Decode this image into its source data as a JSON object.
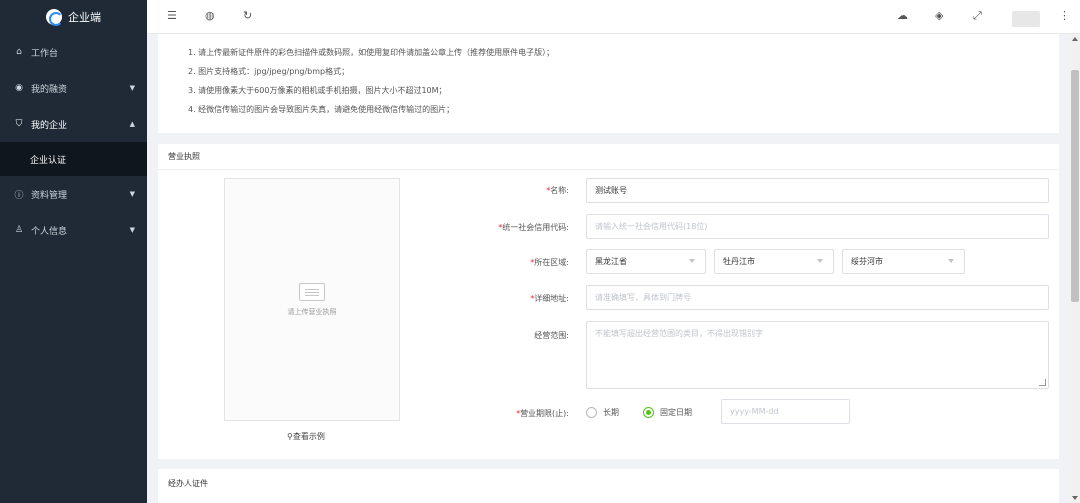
{
  "sidebar": {
    "brand": "企业端",
    "items": [
      {
        "label": "工作台",
        "icon": "home-icon"
      },
      {
        "label": "我的融资",
        "icon": "finance-icon"
      },
      {
        "label": "我的企业",
        "icon": "shield-icon"
      },
      {
        "label": "资料管理",
        "icon": "info-icon"
      },
      {
        "label": "个人信息",
        "icon": "user-icon"
      }
    ],
    "sub_items": [
      {
        "label": "企业认证"
      }
    ]
  },
  "topbar": {
    "icons": [
      "menu-icon",
      "globe-icon",
      "refresh-icon",
      "palette-icon",
      "tag-icon",
      "fullscreen-icon",
      "more-icon"
    ]
  },
  "notes": [
    "1. 请上传最新证件原件的彩色扫描件或数码照，如使用复印件请加盖公章上传（推荐使用原件电子版）；",
    "2. 图片支持格式：jpg/jpeg/png/bmp格式；",
    "3. 请使用像素大于600万像素的相机或手机拍摄，图片大小不超过10M；",
    "4. 经微信传输过的图片会导致图片失真，请避免使用经微信传输过的图片；"
  ],
  "license": {
    "title": "营业执照",
    "upload_text": "请上传营业执照",
    "example_link": "查看示例",
    "fields": {
      "name_label": "名称:",
      "name_value": "测试账号",
      "credit_label": "统一社会信用代码:",
      "credit_placeholder": "请输入统一社会信用代码(18位)",
      "region_label": "所在区域:",
      "province": "黑龙江省",
      "city": "牡丹江市",
      "district": "绥芬河市",
      "address_label": "详细地址:",
      "address_placeholder": "请准确填写，具体到门牌号",
      "scope_label": "经营范围:",
      "scope_placeholder": "不能填写超出经营范围的类目，不得出现错别字",
      "term_label": "营业期限(止):",
      "option_long": "长期",
      "option_fixed": "固定日期",
      "date_placeholder": "yyyy-MM-dd"
    }
  },
  "agent": {
    "title": "经办人证件"
  },
  "colors": {
    "sidebar_bg": "#1f2a36",
    "submenu_bg": "#10161d",
    "required": "#f5222d",
    "radio_checked": "#52c41a"
  }
}
